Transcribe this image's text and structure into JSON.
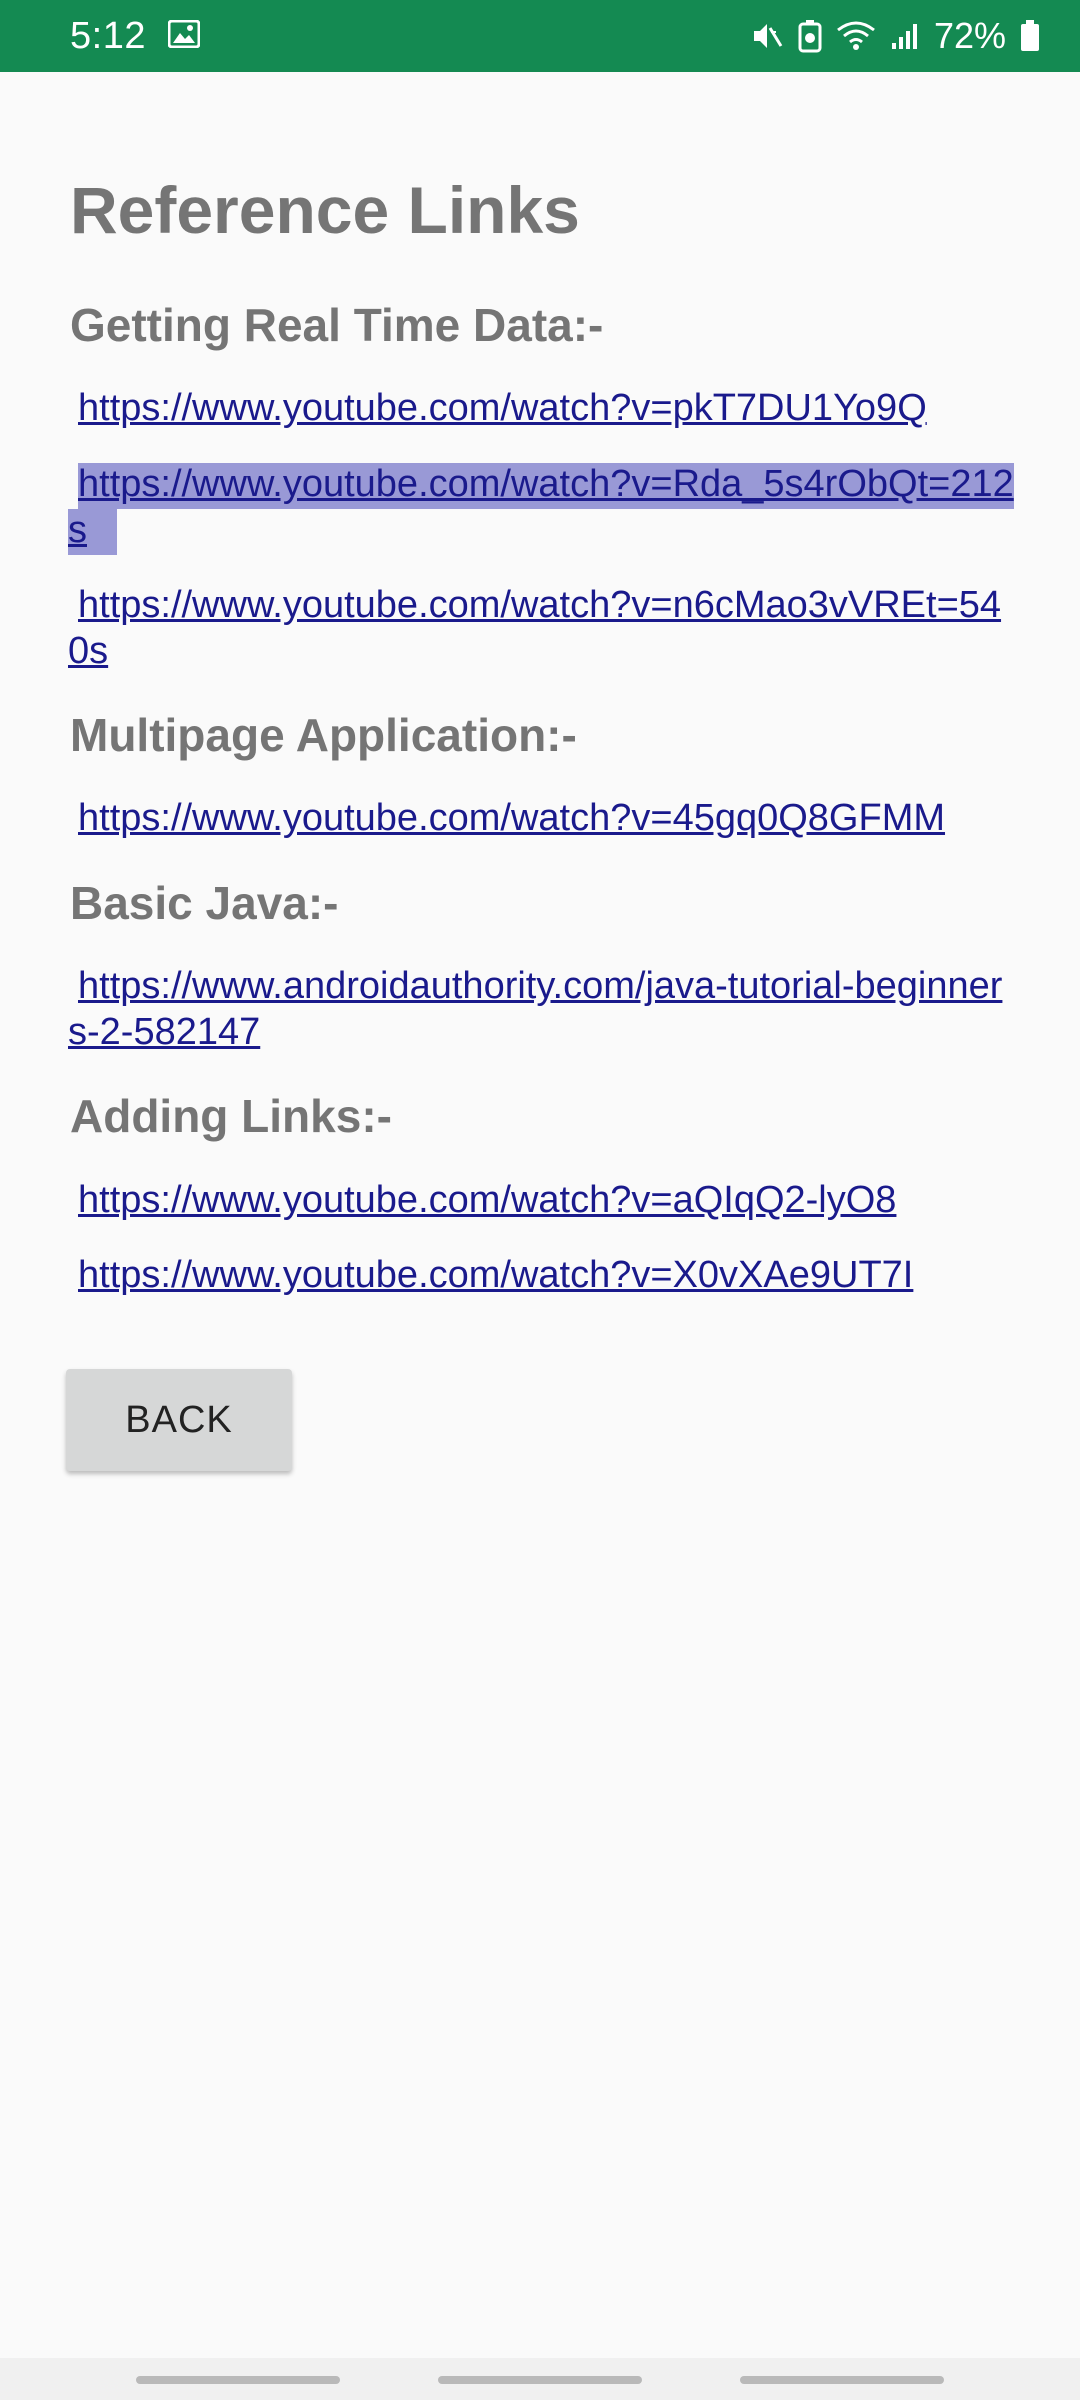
{
  "status_bar": {
    "time": "5:12",
    "battery_percent": "72%",
    "icons": [
      "gallery-icon",
      "mute-icon",
      "battery-saver-icon",
      "wifi-icon",
      "signal-icon",
      "battery-icon"
    ]
  },
  "page": {
    "title": "Reference Links"
  },
  "sections": [
    {
      "heading": "Getting Real Time Data:-",
      "links": [
        "https://www.youtube.com/watch?v=pkT7DU1Yo9Q",
        "https://www.youtube.com/watch?v=Rda_5s4rObQt=212s",
        "https://www.youtube.com/watch?v=n6cMao3vVREt=540s"
      ]
    },
    {
      "heading": "Multipage Application:-",
      "links": [
        "https://www.youtube.com/watch?v=45gq0Q8GFMM"
      ]
    },
    {
      "heading": "Basic Java:-",
      "links": [
        "https://www.androidauthority.com/java-tutorial-beginners-2-582147"
      ]
    },
    {
      "heading": "Adding Links:-",
      "links": [
        "https://www.youtube.com/watch?v=aQIqQ2-lyO8",
        "https://www.youtube.com/watch?v=X0vXAe9UT7I"
      ]
    }
  ],
  "back_button": {
    "label": "BACK"
  },
  "colors": {
    "status_bar": "#148a52",
    "heading_text": "#757575",
    "link_text": "#1a1a8c",
    "selection_highlight": "#9999d6",
    "button_bg": "#d6d7d7"
  }
}
